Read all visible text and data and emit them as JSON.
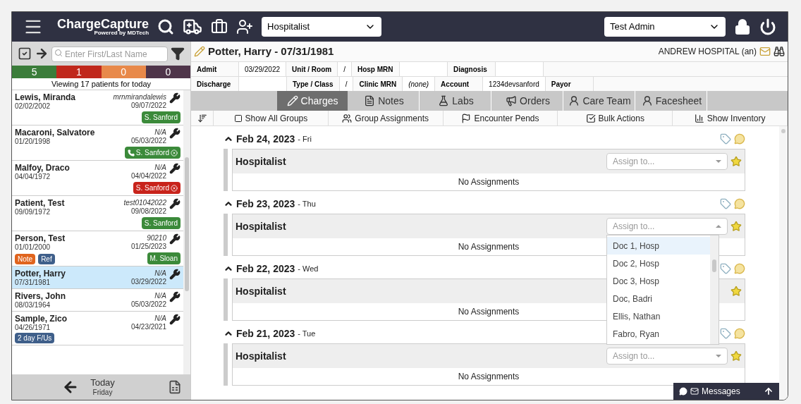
{
  "header": {
    "logo": "ChargeCapture",
    "logo_sub": "Powered by MDTech",
    "group_select": "Hospitalist",
    "user_select": "Test Admin"
  },
  "sidebar": {
    "search": {
      "placeholder": "Enter First/Last Name"
    },
    "counts": [
      {
        "value": "5",
        "color": "#3b7d3a"
      },
      {
        "value": "1",
        "color": "#c0281c"
      },
      {
        "value": "0",
        "color": "#e8894a"
      },
      {
        "value": "0",
        "color": "#4f354a"
      }
    ],
    "viewing": "Viewing 17 patients for today",
    "patients": [
      {
        "name": "Lewis, Miranda",
        "dob": "02/02/2002",
        "mrn": "mrnmirandalewis",
        "date": "09/07/2022",
        "selected": false,
        "badges": [
          {
            "label": "S. Sanford",
            "color": "#3b8a3a",
            "phone": false,
            "removable": false
          }
        ]
      },
      {
        "name": "Macaroni, Salvatore",
        "dob": "01/20/1998",
        "mrn": "N/A",
        "date": "05/03/2022",
        "selected": false,
        "badges": [
          {
            "label": "S. Sanford",
            "color": "#3b8a3a",
            "phone": true,
            "removable": true
          }
        ]
      },
      {
        "name": "Malfoy, Draco",
        "dob": "04/04/1972",
        "mrn": "N/A",
        "date": "04/04/2022",
        "selected": false,
        "badges": [
          {
            "label": "S. Sanford",
            "color": "#c8231b",
            "phone": false,
            "removable": true
          }
        ]
      },
      {
        "name": "Patient, Test",
        "dob": "09/09/1972",
        "mrn": "test01042022",
        "date": "09/08/2022",
        "selected": false,
        "badges": [
          {
            "label": "S. Sanford",
            "color": "#3b8a3a",
            "phone": false,
            "removable": false
          }
        ]
      },
      {
        "name": "Person, Test",
        "dob": "01/01/2000",
        "mrn": "90210",
        "date": "01/25/2023",
        "selected": false,
        "tags": [
          {
            "label": "Note",
            "color": "#e0641e"
          },
          {
            "label": "Ref",
            "color": "#3f5f8a"
          }
        ],
        "badges": [
          {
            "label": "M. Sloan",
            "color": "#3b8a3a",
            "phone": false,
            "removable": false
          }
        ]
      },
      {
        "name": "Potter, Harry",
        "dob": "07/31/1981",
        "mrn": "N/A",
        "date": "03/29/2022",
        "selected": true
      },
      {
        "name": "Rivers, John",
        "dob": "08/03/1964",
        "mrn": "N/A",
        "date": "05/03/2022",
        "selected": false
      },
      {
        "name": "Sample, Zico",
        "dob": "04/26/1971",
        "mrn": "N/A",
        "date": "04/23/2021",
        "selected": false,
        "tags": [
          {
            "label": "2 day F/Us",
            "color": "#3f5f8a"
          }
        ]
      }
    ],
    "footer": {
      "label": "Today",
      "sub": "Friday"
    }
  },
  "patient": {
    "title": "Potter, Harry - 07/31/1981",
    "facility": "ANDREW HOSPITAL (an)",
    "info_rows": [
      [
        {
          "kind": "label",
          "text": "Admit"
        },
        {
          "kind": "value",
          "text": "03/29/2022"
        },
        {
          "kind": "label",
          "text": "Unit / Room"
        },
        {
          "kind": "value",
          "text": "/"
        },
        {
          "kind": "label",
          "text": "Hosp MRN"
        },
        {
          "kind": "value",
          "text": ""
        },
        {
          "kind": "label",
          "text": "Diagnosis"
        },
        {
          "kind": "value",
          "text": ""
        }
      ],
      [
        {
          "kind": "label",
          "text": "Discharge"
        },
        {
          "kind": "value",
          "text": ""
        },
        {
          "kind": "label",
          "text": "Type / Class"
        },
        {
          "kind": "value",
          "text": "/"
        },
        {
          "kind": "label",
          "text": "Clinic MRN"
        },
        {
          "kind": "value",
          "text": "(none)"
        },
        {
          "kind": "label",
          "text": "Account"
        },
        {
          "kind": "value",
          "text": "1234devsanford"
        },
        {
          "kind": "label",
          "text": "Payor"
        }
      ]
    ]
  },
  "tabs": [
    {
      "label": "Charges",
      "selected": true
    },
    {
      "label": "Notes",
      "selected": false
    },
    {
      "label": "Labs",
      "selected": false
    },
    {
      "label": "Orders",
      "selected": false
    },
    {
      "label": "Care Team",
      "selected": false
    },
    {
      "label": "Facesheet",
      "selected": false
    }
  ],
  "toolbar": [
    {
      "label": "Show All Groups",
      "kind": "checkbox",
      "checked": false
    },
    {
      "label": "Group Assignments",
      "kind": "button"
    },
    {
      "label": "Encounter Pends",
      "kind": "button"
    },
    {
      "label": "Bulk Actions",
      "kind": "button"
    },
    {
      "label": "Show Inventory",
      "kind": "button"
    }
  ],
  "days": [
    {
      "date": "Feb 24, 2023",
      "weekday": "- Fri",
      "group": "Hospitalist",
      "empty": "No Assignments",
      "assign_placeholder": "Assign to...",
      "open": false
    },
    {
      "date": "Feb 23, 2023",
      "weekday": "- Thu",
      "group": "Hospitalist",
      "empty": "No Assignments",
      "assign_placeholder": "Assign to...",
      "open": true
    },
    {
      "date": "Feb 22, 2023",
      "weekday": "- Wed",
      "group": "Hospitalist",
      "empty": "No Assignments"
    },
    {
      "date": "Feb 21, 2023",
      "weekday": "- Tue",
      "group": "Hospitalist",
      "empty": "No Assignments",
      "assign_placeholder": "Assign to...",
      "open": false
    }
  ],
  "dropdown_options": [
    {
      "label": "Doc 1, Hosp",
      "selected": true
    },
    {
      "label": "Doc 2, Hosp",
      "selected": false
    },
    {
      "label": "Doc 3, Hosp",
      "selected": false
    },
    {
      "label": "Doc, Badri",
      "selected": false
    },
    {
      "label": "Ellis, Nathan",
      "selected": false
    },
    {
      "label": "Fabro, Ryan",
      "selected": false
    }
  ],
  "messages": "Messages"
}
